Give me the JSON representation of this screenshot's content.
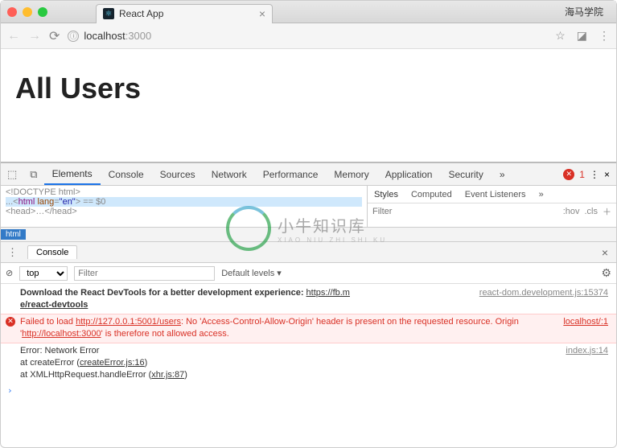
{
  "window": {
    "tab_title": "React App",
    "titlebar_right": "海马学院"
  },
  "address": {
    "host": "localhost",
    "port": ":3000",
    "info_glyph": "ⓘ"
  },
  "page": {
    "heading": "All Users"
  },
  "devtools": {
    "tabs": [
      "Elements",
      "Console",
      "Sources",
      "Network",
      "Performance",
      "Memory",
      "Application",
      "Security"
    ],
    "more": "»",
    "error_count": "1",
    "dom": {
      "l1": "<!DOCTYPE html>",
      "l2_pre": "...<",
      "l2_tag": "html",
      "l2_attr": "lang",
      "l2_val": "\"en\"",
      "l2_post": "> == $0",
      "l3": "  <head>…</head>"
    },
    "styles": {
      "tabs": [
        "Styles",
        "Computed",
        "Event Listeners"
      ],
      "more": "»",
      "filter_placeholder": "Filter",
      "hov": ":hov",
      "cls": ".cls"
    },
    "breadcrumb": "html",
    "drawer_tab": "Console",
    "toolbar": {
      "context": "top",
      "filter_placeholder": "Filter",
      "levels": "Default levels ▾"
    },
    "log": {
      "msg1_a": "Download the React DevTools for a better development experience: ",
      "msg1_link": "https://fb.m",
      "msg1_loc": "react-dom.development.js:15374",
      "msg1_b": "e/react-devtools",
      "err_a": "Failed to load ",
      "err_url1": "http://127.0.0.1:5001/users",
      "err_b": ": No 'Access-Control-Allow-Origin' header is present on the requested resource. Origin '",
      "err_url2": "http://localhost:3000",
      "err_c": "' is therefore not allowed access.",
      "err_loc": "localhost/:1",
      "trace_head": "Error: Network Error",
      "trace_loc": "index.js:14",
      "trace1_a": "    at createError (",
      "trace1_link": "createError.js:16",
      "trace1_b": ")",
      "trace2_a": "    at XMLHttpRequest.handleError (",
      "trace2_link": "xhr.js:87",
      "trace2_b": ")"
    }
  },
  "watermark": {
    "main": "小牛知识库",
    "sub": "XIAO NIU ZHI SHI KU"
  }
}
